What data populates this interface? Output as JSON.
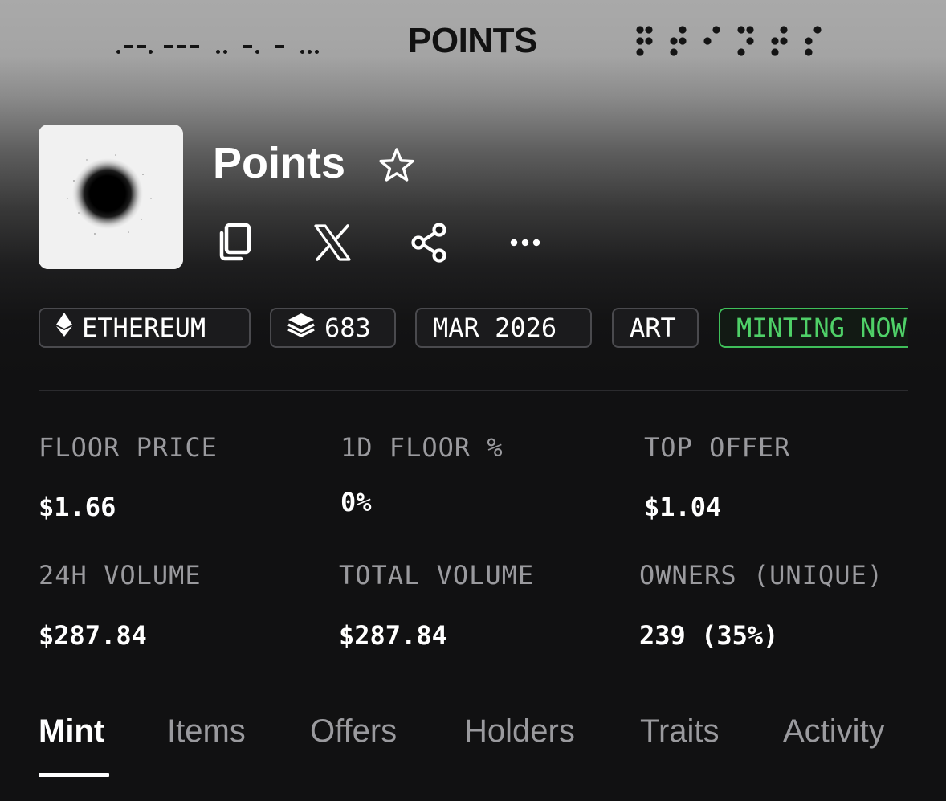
{
  "banner": {
    "morse_text": ".--. --- .. -. - ...",
    "title": "POINTS",
    "braille_label": "⠏⠕⠊⠝⠞⠎"
  },
  "collection": {
    "name": "Points",
    "favorite_icon": "star-outline-icon",
    "actions": [
      {
        "name": "copy",
        "icon": "copy-icon"
      },
      {
        "name": "x",
        "icon": "x-logo-icon"
      },
      {
        "name": "share",
        "icon": "share-icon"
      },
      {
        "name": "more",
        "icon": "more-horizontal-icon"
      }
    ]
  },
  "tags": {
    "chain": "ETHEREUM",
    "chain_icon": "ethereum-icon",
    "items": "683",
    "items_icon": "layers-icon",
    "date": "MAR 2026",
    "category": "ART",
    "status": "MINTING NOW",
    "status_color": "#4fd068"
  },
  "stats": {
    "floor_price": {
      "label": "FLOOR PRICE",
      "value": "$1.66"
    },
    "floor_change": {
      "label": "1D FLOOR %",
      "value": "0%"
    },
    "top_offer": {
      "label": "TOP OFFER",
      "value": "$1.04"
    },
    "volume_24h": {
      "label": "24H VOLUME",
      "value": "$287.84"
    },
    "total_volume": {
      "label": "TOTAL VOLUME",
      "value": "$287.84"
    },
    "owners": {
      "label": "OWNERS (UNIQUE)",
      "value": "239 (35%)"
    }
  },
  "tabs": [
    {
      "label": "Mint",
      "active": true
    },
    {
      "label": "Items",
      "active": false
    },
    {
      "label": "Offers",
      "active": false
    },
    {
      "label": "Holders",
      "active": false
    },
    {
      "label": "Traits",
      "active": false
    },
    {
      "label": "Activity",
      "active": false
    }
  ],
  "colors": {
    "background": "#111112",
    "accent_green": "#4fd068",
    "muted_text": "#9a9a9e"
  }
}
